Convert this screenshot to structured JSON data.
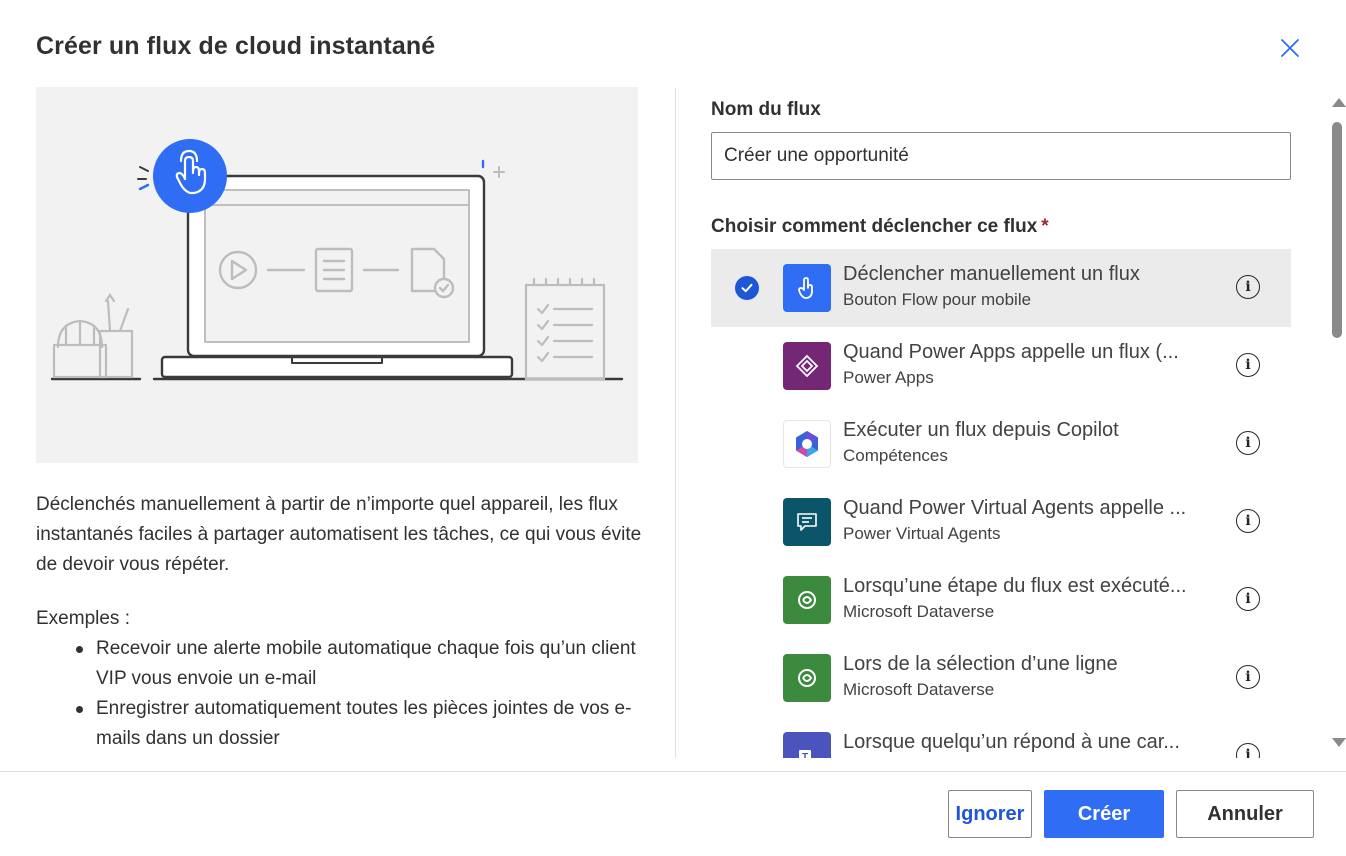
{
  "dialog": {
    "title": "Créer un flux de cloud instantané",
    "close_icon": "close-icon"
  },
  "left": {
    "description": "Déclenchés manuellement à partir de n’importe quel appareil, les flux instantanés faciles à partager automatisent les tâches, ce qui vous évite de devoir vous répéter.",
    "examples_title": "Exemples :",
    "examples": [
      "Recevoir une alerte mobile automatique chaque fois qu’un client VIP vous envoie un e-mail",
      "Enregistrer automatiquement toutes les pièces jointes de vos e-mails dans un dossier"
    ]
  },
  "form": {
    "name_label": "Nom du flux",
    "name_value": "Créer une opportunité",
    "trigger_label": "Choisir comment déclencher ce flux",
    "required_mark": "*"
  },
  "triggers": [
    {
      "title": "Déclencher manuellement un flux",
      "subtitle": "Bouton Flow pour mobile",
      "selected": true,
      "icon": "touch-button-icon",
      "color": "#2f6df4"
    },
    {
      "title": "Quand Power Apps appelle un flux (...",
      "subtitle": "Power Apps",
      "selected": false,
      "icon": "power-apps-icon",
      "color": "#742774"
    },
    {
      "title": "Exécuter un flux depuis Copilot",
      "subtitle": "Compétences",
      "selected": false,
      "icon": "copilot-icon",
      "color": "#ffffff"
    },
    {
      "title": "Quand Power Virtual Agents appelle ...",
      "subtitle": "Power Virtual Agents",
      "selected": false,
      "icon": "power-virtual-agents-icon",
      "color": "#0b556a"
    },
    {
      "title": "Lorsqu’une étape du flux est exécuté...",
      "subtitle": "Microsoft Dataverse",
      "selected": false,
      "icon": "dataverse-icon",
      "color": "#3b8a3e"
    },
    {
      "title": "Lors de la sélection d’une ligne",
      "subtitle": "Microsoft Dataverse",
      "selected": false,
      "icon": "dataverse-icon",
      "color": "#3b8a3e"
    },
    {
      "title": "Lorsque quelqu’un répond à une car...",
      "subtitle": "",
      "selected": false,
      "icon": "teams-icon",
      "color": "#4b53bc"
    }
  ],
  "footer": {
    "skip_label": "Ignorer",
    "create_label": "Créer",
    "cancel_label": "Annuler"
  },
  "colors": {
    "accent": "#2f6df4",
    "check": "#1e56d6",
    "selected_row": "#ebebeb"
  }
}
